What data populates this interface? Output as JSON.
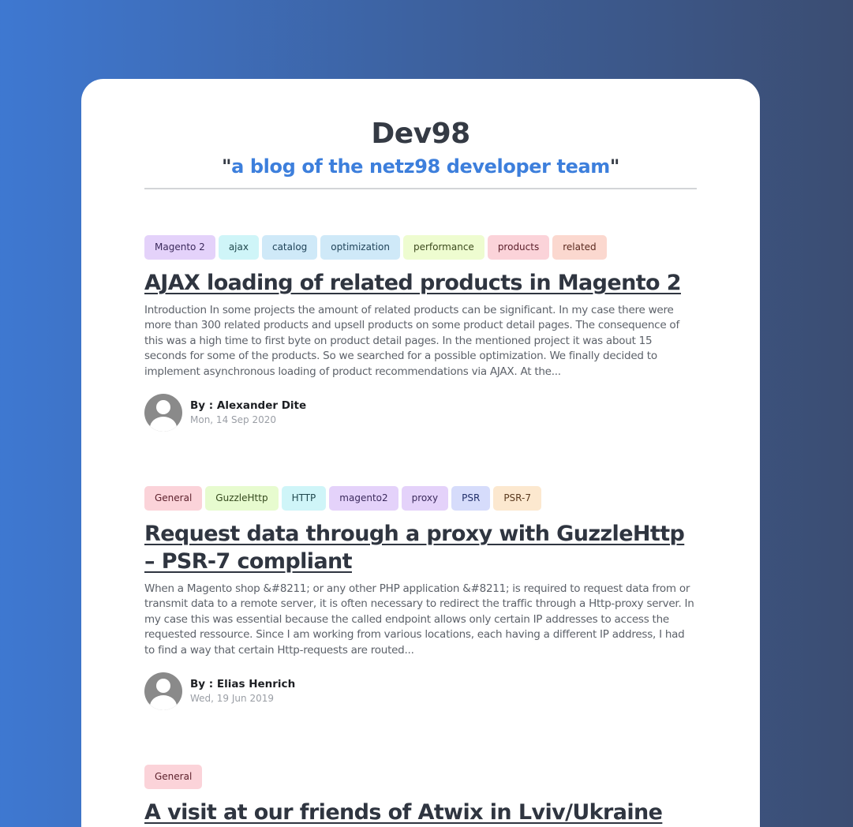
{
  "site": {
    "title": "Dev98",
    "subtitle_open_quote": "\"",
    "subtitle": "a blog of the netz98 developer team",
    "subtitle_close_quote": "\""
  },
  "posts": [
    {
      "tags": [
        {
          "label": "Magento 2",
          "color": "#e4d2fa"
        },
        {
          "label": "ajax",
          "color": "#cff5f8"
        },
        {
          "label": "catalog",
          "color": "#cfe9f8"
        },
        {
          "label": "optimization",
          "color": "#cfe9f8"
        },
        {
          "label": "performance",
          "color": "#eefcd0"
        },
        {
          "label": "products",
          "color": "#fbd3d9"
        },
        {
          "label": "related",
          "color": "#fbd8cf"
        }
      ],
      "title": "AJAX loading of related products in Magento 2",
      "excerpt": "Introduction In some projects the amount of related products can be significant. In my case there were more than 300 related products and upsell products on some product detail pages. The consequence of this was a high time to first byte on product detail pages. In the mentioned project it was about 15 seconds for some of the products. So we searched for a possible optimization. We finally decided to implement asynchronous loading of product recommendations via AJAX. At the...",
      "author": "By : Alexander Dite",
      "date": "Mon, 14 Sep 2020"
    },
    {
      "tags": [
        {
          "label": "General",
          "color": "#fbd3d9"
        },
        {
          "label": "GuzzleHttp",
          "color": "#e7fbcf"
        },
        {
          "label": "HTTP",
          "color": "#cff5f8"
        },
        {
          "label": "magento2",
          "color": "#e4d2fa"
        },
        {
          "label": "proxy",
          "color": "#e4d2fa"
        },
        {
          "label": "PSR",
          "color": "#d6dcfb"
        },
        {
          "label": "PSR-7",
          "color": "#fce8cf"
        }
      ],
      "title": "Request data through a proxy with GuzzleHttp – PSR-7 compliant",
      "excerpt": "When a Magento shop &#8211; or any other PHP application &#8211; is required to request data from or transmit data to a remote server, it is often necessary to redirect the traffic through a Http-proxy server. In my case this was essential because the called endpoint allows only certain IP addresses to access the requested ressource. Since I am working from various locations, each having a different IP address, I had to find a way that certain Http-requests are routed...",
      "author": "By : Elias Henrich",
      "date": "Wed, 19 Jun 2019"
    },
    {
      "tags": [
        {
          "label": "General",
          "color": "#fbd3d9"
        }
      ],
      "title": "A visit at our friends of Atwix in Lviv/Ukraine"
    }
  ]
}
